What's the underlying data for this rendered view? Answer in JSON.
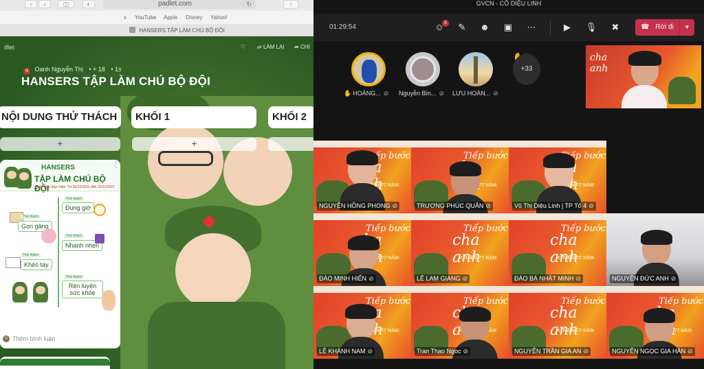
{
  "safari": {
    "url": "padlet.com",
    "favorites": [
      "x",
      "YouTube",
      "Apple",
      "Disney",
      "Yahoo!"
    ],
    "tab_title": "HANSERS TẬP LÀM CHÚ BỘ ĐỘI"
  },
  "padlet": {
    "logo": "dlet",
    "remake_label": "LÀM LẠI",
    "share_label": "CHI",
    "author": "Oanh Nguyễn Thị",
    "likes": "+ 18",
    "time": "1s",
    "author_initial": "N",
    "title": "HANSERS TẬP LÀM CHÚ BỘ ĐỘI",
    "columns": [
      "NỘI DUNG THỬ THÁCH",
      "KHỐI 1",
      "KHỐI 2"
    ],
    "add_symbol": "+",
    "post": {
      "heading1": "HANSERS",
      "heading2": "TẬP LÀM CHÚ BỘ ĐỘI",
      "heading3": "Thời gian thực hiện: Từ 05/12/2021 đến 22/12/2021",
      "chips": [
        "Đúng giờ",
        "Gọn gàng",
        "Nhanh nhẹn",
        "Khéo tay",
        "Rèn luyện sức khỏe"
      ],
      "chip_tags": [
        "Thử thách",
        "Thử thách",
        "Thử thách",
        "Thử thách",
        "Thử thách"
      ],
      "more": "⋮"
    },
    "comment_placeholder": "Thêm bình luận",
    "comment_initial": "V"
  },
  "teams": {
    "window_title": "GVCN - CÔ DIỆU LINH",
    "timer": "01:29:54",
    "participants_badge": "5",
    "leave_label": "Rời đi",
    "strip": [
      {
        "name": "HOÀNG...",
        "hand": true
      },
      {
        "name": "Nguyễn Bìn...",
        "hand": false
      },
      {
        "name": "LƯU HOÀN...",
        "hand": false
      }
    ],
    "more_count": "+33",
    "host_poster_text": "Tiếp bước cha anh",
    "poster": {
      "word1": "Tiếp bước",
      "word2": "cha anh",
      "sub": "KỈ NIỆM 77 NĂM"
    },
    "tiles": [
      {
        "name": "NGUYỄN HỒNG PHONG",
        "type": "poster"
      },
      {
        "name": "TRƯƠNG PHÚC QUÂN",
        "type": "poster"
      },
      {
        "name": "Vũ Thị Diệu Linh | TP Tổ 4",
        "type": "poster"
      },
      {
        "name": "ĐÀO MINH HIỂN",
        "type": "poster"
      },
      {
        "name": "LÊ LAM GIANG",
        "type": "poster"
      },
      {
        "name": "ĐÀO BÁ NHẬT MINH",
        "type": "poster"
      },
      {
        "name": "NGUYỄN ĐỨC ANH",
        "type": "plain"
      },
      {
        "name": "LÊ KHÁNH NAM",
        "type": "poster"
      },
      {
        "name": "Tran Thao Ngoc",
        "type": "poster"
      },
      {
        "name": "NGUYỄN TRẦN GIA AN",
        "type": "poster"
      },
      {
        "name": "NGUYỄN NGỌC GIA HÂN",
        "type": "poster"
      }
    ],
    "colors": {
      "leave": "#c4314b",
      "hand": "#f0b400",
      "poster": "#e1402a"
    }
  }
}
